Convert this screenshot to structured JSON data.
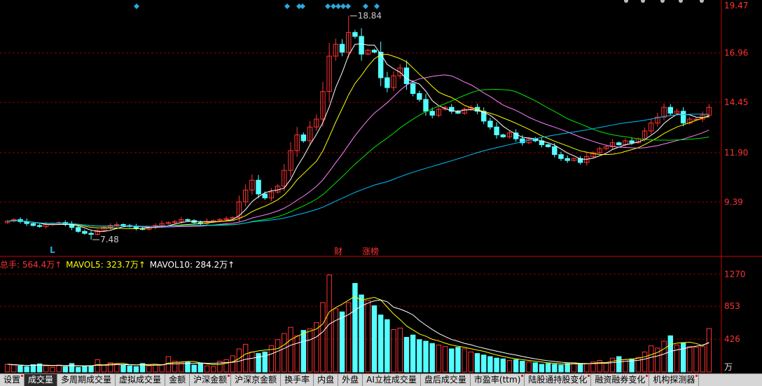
{
  "tabs": [
    {
      "label": "设置",
      "dot": true
    },
    {
      "label": "成交量",
      "active": true
    },
    {
      "label": "多周期成交量"
    },
    {
      "label": "虚拟成交量"
    },
    {
      "label": "金额"
    },
    {
      "label": "沪深金额",
      "dot": true
    },
    {
      "label": "沪深京金额"
    },
    {
      "label": "换手率"
    },
    {
      "label": "内盘"
    },
    {
      "label": "外盘"
    },
    {
      "label": "AI立桩成交量"
    },
    {
      "label": "盘后成交量"
    },
    {
      "label": "市盈率(ttm)",
      "dot": true
    },
    {
      "label": "陆股通持股变化",
      "dot": true
    },
    {
      "label": "融资融券变化",
      "dot": true
    },
    {
      "label": "机构探测器",
      "dot": true
    }
  ],
  "volume_legend": {
    "total_label": "总手: 564.4万↑",
    "ma5_label": "MAVOL5: 323.7万↑",
    "ma10_label": "MAVOL10: 284.2万↑"
  },
  "price_annotations": {
    "high_label": "18.84",
    "low_label": "7.48",
    "low_marker": "L",
    "news_labels": [
      "财",
      "涨榜"
    ]
  },
  "colors": {
    "up": "#ff3232",
    "down": "#54ffff",
    "ma5": "#ffffff",
    "ma10": "#ffff00",
    "ma20": "#ff80ff",
    "ma30": "#00e600",
    "ma60": "#00bfff",
    "axis": "#cc0000",
    "text_red": "#ff3232",
    "text_yellow": "#ffff00",
    "diamond": "#2aa8e0"
  },
  "chart_data": [
    {
      "type": "candlestick",
      "yticks": [
        "19.47",
        "16.96",
        "14.45",
        "11.90",
        "9.39"
      ],
      "ylim": [
        7.2,
        19.47
      ],
      "count": 110,
      "high_index": 53,
      "low_index": 13,
      "closes": [
        8.42,
        8.5,
        8.4,
        8.3,
        8.2,
        8.15,
        8.25,
        8.3,
        8.35,
        8.25,
        8.1,
        7.9,
        7.8,
        7.75,
        7.95,
        8.1,
        8.2,
        8.25,
        8.2,
        8.15,
        8.05,
        8.0,
        8.1,
        8.2,
        8.3,
        8.35,
        8.4,
        8.5,
        8.45,
        8.35,
        8.3,
        8.4,
        8.45,
        8.5,
        8.55,
        8.6,
        9.4,
        10.0,
        10.5,
        9.8,
        9.6,
        9.9,
        10.2,
        11.0,
        12.0,
        12.8,
        12.5,
        13.2,
        13.6,
        15.0,
        16.8,
        17.4,
        17.0,
        18.0,
        17.8,
        16.9,
        17.1,
        17.0,
        15.7,
        15.2,
        15.8,
        16.2,
        15.4,
        14.9,
        14.6,
        14.0,
        13.8,
        14.1,
        14.2,
        14.0,
        13.9,
        14.1,
        14.2,
        14.0,
        13.5,
        13.2,
        12.8,
        12.7,
        12.9,
        12.6,
        12.4,
        12.6,
        12.5,
        12.3,
        12.2,
        11.8,
        11.6,
        11.5,
        11.6,
        11.4,
        11.7,
        11.9,
        12.1,
        12.2,
        12.4,
        12.3,
        12.5,
        12.4,
        12.6,
        13.0,
        13.4,
        13.7,
        14.2,
        13.9,
        14.0,
        13.4,
        13.6,
        13.6,
        13.8,
        14.2
      ]
    },
    {
      "type": "bar",
      "yticks": [
        "1270",
        "853",
        "426"
      ],
      "unit": "万",
      "ylim": [
        0,
        1300
      ],
      "values": [
        100,
        90,
        80,
        70,
        95,
        105,
        80,
        60,
        90,
        70,
        110,
        60,
        70,
        80,
        160,
        90,
        120,
        100,
        90,
        80,
        70,
        110,
        80,
        100,
        90,
        200,
        140,
        120,
        130,
        90,
        110,
        80,
        70,
        140,
        160,
        210,
        300,
        360,
        260,
        240,
        260,
        340,
        420,
        500,
        580,
        470,
        540,
        560,
        640,
        900,
        1260,
        820,
        780,
        900,
        1150,
        1000,
        930,
        860,
        740,
        680,
        550,
        570,
        450,
        480,
        420,
        400,
        370,
        350,
        330,
        300,
        320,
        300,
        260,
        240,
        220,
        200,
        180,
        170,
        150,
        160,
        140,
        130,
        120,
        100,
        110,
        100,
        90,
        110,
        120,
        100,
        110,
        130,
        150,
        120,
        180,
        200,
        160,
        170,
        190,
        260,
        340,
        310,
        400,
        470,
        350,
        380,
        330,
        320,
        330,
        564
      ]
    }
  ]
}
